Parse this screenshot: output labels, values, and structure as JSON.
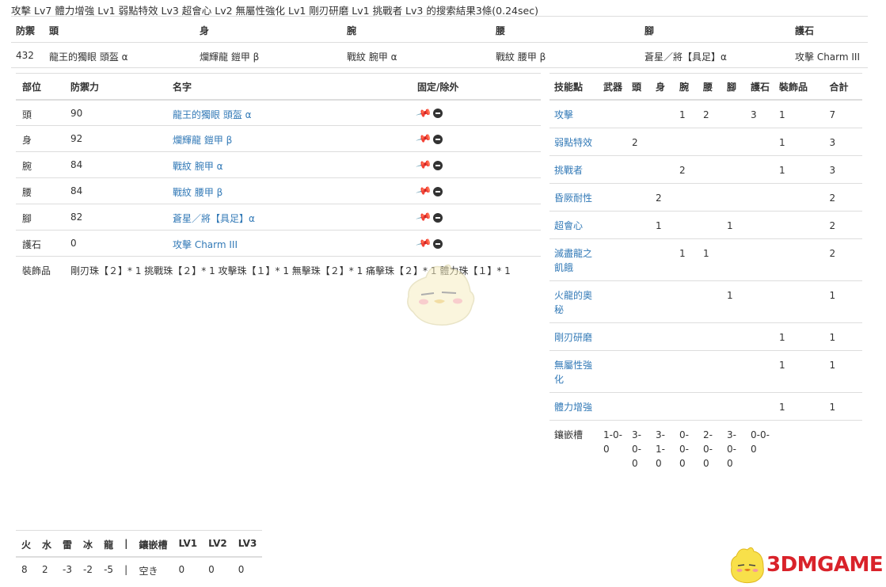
{
  "summary": "攻擊 Lv7 體力增強 Lv1 弱點特效 Lv3 超會心 Lv2 無屬性強化 Lv1 剛刃研磨 Lv1 挑戰者 Lv3 的搜索結果3條(0.24sec)",
  "result_table": {
    "headers": [
      "防禦",
      "頭",
      "身",
      "腕",
      "腰",
      "腳",
      "護石"
    ],
    "row": [
      "432",
      "龍王的獨眼 頭盔 α",
      "爛輝龍 鎧甲 β",
      "戰紋 腕甲 α",
      "戰紋 腰甲 β",
      "蒼星／將【具足】α",
      "攻擊 Charm III"
    ]
  },
  "detail_table": {
    "headers": [
      "部位",
      "防禦力",
      "名字",
      "固定/除外"
    ],
    "rows": [
      {
        "part": "頭",
        "defense": "90",
        "name": "龍王的獨眼 頭盔 α"
      },
      {
        "part": "身",
        "defense": "92",
        "name": "爛輝龍 鎧甲 β"
      },
      {
        "part": "腕",
        "defense": "84",
        "name": "戰紋 腕甲 α"
      },
      {
        "part": "腰",
        "defense": "84",
        "name": "戰紋 腰甲 β"
      },
      {
        "part": "腳",
        "defense": "82",
        "name": "蒼星／將【具足】α"
      },
      {
        "part": "護石",
        "defense": "0",
        "name": "攻擊 Charm III"
      }
    ],
    "deco_label": "裝飾品",
    "deco_text": "剛刃珠【２】* 1 挑戰珠【２】* 1 攻擊珠【１】* 1 無擊珠【２】* 1 痛擊珠【２】* 1 體力珠【１】* 1"
  },
  "skills_table": {
    "headers": [
      "技能點",
      "武器",
      "頭",
      "身",
      "腕",
      "腰",
      "腳",
      "護石",
      "裝飾品",
      "合計"
    ],
    "rows": [
      {
        "name": "攻擊",
        "cells": [
          "",
          "",
          "",
          "1",
          "2",
          "",
          "3",
          "1",
          "7"
        ]
      },
      {
        "name": "弱點特效",
        "cells": [
          "",
          "2",
          "",
          "",
          "",
          "",
          "",
          "1",
          "3"
        ]
      },
      {
        "name": "挑戰者",
        "cells": [
          "",
          "",
          "",
          "2",
          "",
          "",
          "",
          "1",
          "3"
        ]
      },
      {
        "name": "昏厥耐性",
        "cells": [
          "",
          "",
          "2",
          "",
          "",
          "",
          "",
          "",
          "2"
        ]
      },
      {
        "name": "超會心",
        "cells": [
          "",
          "",
          "1",
          "",
          "",
          "1",
          "",
          "",
          "2"
        ]
      },
      {
        "name": "滅盡龍之飢餓",
        "cells": [
          "",
          "",
          "",
          "1",
          "1",
          "",
          "",
          "",
          "2"
        ]
      },
      {
        "name": "火龍的奧秘",
        "cells": [
          "",
          "",
          "",
          "",
          "",
          "1",
          "",
          "",
          "1"
        ]
      },
      {
        "name": "剛刃研磨",
        "cells": [
          "",
          "",
          "",
          "",
          "",
          "",
          "",
          "1",
          "1"
        ]
      },
      {
        "name": "無屬性強化",
        "cells": [
          "",
          "",
          "",
          "",
          "",
          "",
          "",
          "1",
          "1"
        ]
      },
      {
        "name": "體力增強",
        "cells": [
          "",
          "",
          "",
          "",
          "",
          "",
          "",
          "1",
          "1"
        ]
      }
    ],
    "slots_label": "鑲嵌槽",
    "slots": [
      "1-0-0",
      "3-0-0",
      "3-1-0",
      "0-0-0",
      "2-0-0",
      "3-0-0",
      "0-0-0"
    ]
  },
  "resist_table": {
    "headers": [
      "火",
      "水",
      "雷",
      "冰",
      "龍",
      "|",
      "鑲嵌槽",
      "LV1",
      "LV2",
      "LV3"
    ],
    "row": [
      "8",
      "2",
      "-3",
      "-2",
      "-5",
      "|",
      "空き",
      "0",
      "0",
      "0"
    ]
  },
  "watermark": {
    "text": "3DMGAME",
    "color": "#d9222a"
  },
  "colors": {
    "link": "#337ab7",
    "border": "#dddddd",
    "text": "#333333"
  }
}
